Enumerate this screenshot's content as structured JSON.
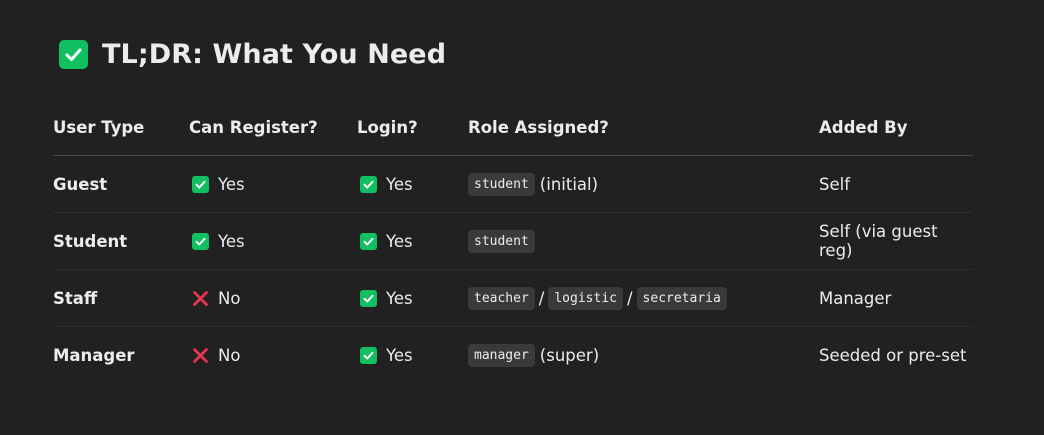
{
  "heading": {
    "icon": "check-box-icon",
    "text": "TL;DR: What You Need"
  },
  "colors": {
    "background": "#212121",
    "yes_green": "#10c060",
    "no_red": "#e8344e"
  },
  "table": {
    "headers": [
      "User Type",
      "Can Register?",
      "Login?",
      "Role Assigned?",
      "Added By"
    ],
    "rows": [
      {
        "user_type": "Guest",
        "can_register": "Yes",
        "can_register_icon": "check-icon",
        "login": "Yes",
        "login_icon": "check-icon",
        "roles": [
          "student"
        ],
        "role_suffix": "(initial)",
        "added_by": "Self"
      },
      {
        "user_type": "Student",
        "can_register": "Yes",
        "can_register_icon": "check-icon",
        "login": "Yes",
        "login_icon": "check-icon",
        "roles": [
          "student"
        ],
        "role_suffix": "",
        "added_by": "Self (via guest reg)"
      },
      {
        "user_type": "Staff",
        "can_register": "No",
        "can_register_icon": "cross-icon",
        "login": "Yes",
        "login_icon": "check-icon",
        "roles": [
          "teacher",
          "logistic",
          "secretaria"
        ],
        "role_separator": "/",
        "role_suffix": "",
        "added_by": "Manager"
      },
      {
        "user_type": "Manager",
        "can_register": "No",
        "can_register_icon": "cross-icon",
        "login": "Yes",
        "login_icon": "check-icon",
        "roles": [
          "manager"
        ],
        "role_suffix": "(super)",
        "added_by": "Seeded or pre-set"
      }
    ]
  }
}
